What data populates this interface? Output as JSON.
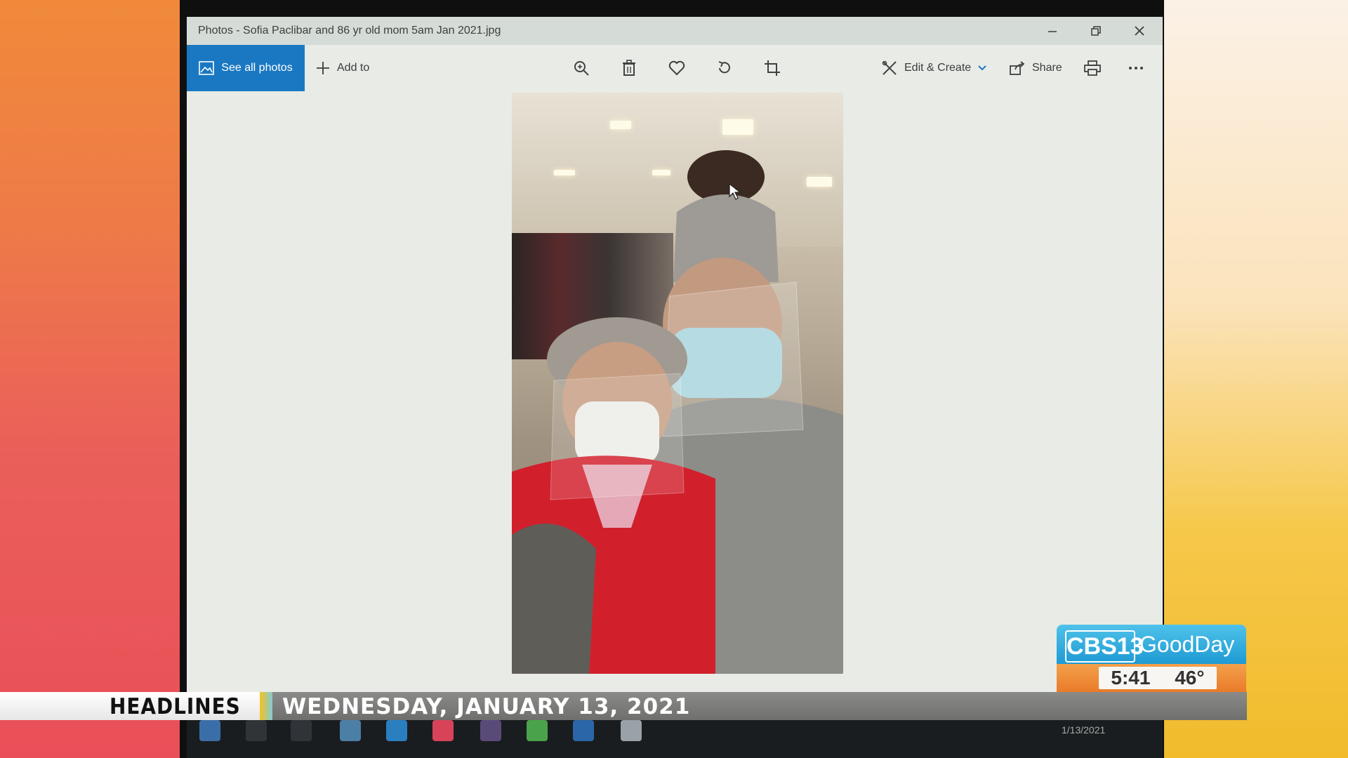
{
  "window": {
    "title": "Photos - Sofia Paclibar and 86 yr old mom 5am Jan 2021.jpg",
    "controls": [
      "minimize",
      "restore",
      "close"
    ]
  },
  "toolbar": {
    "see_all_label": "See all photos",
    "add_to_label": "Add to",
    "edit_create_label": "Edit & Create",
    "share_label": "Share",
    "tools": [
      "zoom-icon",
      "delete-icon",
      "favorite-icon",
      "rotate-icon",
      "crop-icon",
      "print-icon",
      "more-icon"
    ]
  },
  "taskbar": {
    "date": "1/13/2021"
  },
  "broadcast": {
    "headlines_label": "HEADLINES",
    "date_line": "WEDNESDAY, JANUARY 13, 2021",
    "logo_channel": "CBS13",
    "show_name": "GoodDay",
    "time": "5:41",
    "temperature": "46°",
    "colors": {
      "logo_blue": "#1e9ad3",
      "logo_orange": "#ea7b2a",
      "accent_yellow": "#f5c31b"
    }
  }
}
